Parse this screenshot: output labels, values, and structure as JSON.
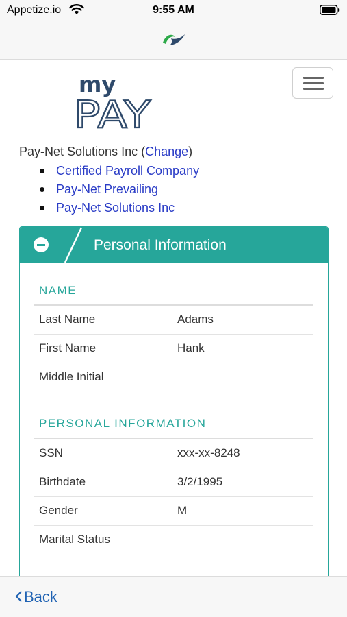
{
  "status_bar": {
    "carrier": "Appetize.io",
    "time": "9:55 AM",
    "icons": [
      "wifi-icon",
      "battery-icon"
    ]
  },
  "header": {
    "logo_icon": "paynet-logo-icon",
    "brand_logo_top": "my",
    "brand_logo_bottom": "PAY",
    "menu_icon": "hamburger-menu-icon"
  },
  "company": {
    "current": "Pay-Net Solutions Inc",
    "open_paren": " (",
    "change_link": "Change",
    "close_paren": ")",
    "options": [
      "Certified Payroll Company",
      "Pay-Net Prevailing",
      "Pay-Net Solutions Inc"
    ]
  },
  "panel": {
    "title": "Personal Information",
    "collapse_icon": "minus-circle-icon",
    "sections": [
      {
        "title": "NAME",
        "rows": [
          {
            "label": "Last Name",
            "value": "Adams"
          },
          {
            "label": "First Name",
            "value": "Hank"
          },
          {
            "label": "Middle Initial",
            "value": ""
          }
        ]
      },
      {
        "title": "PERSONAL INFORMATION",
        "rows": [
          {
            "label": "SSN",
            "value": "xxx-xx-8248"
          },
          {
            "label": "Birthdate",
            "value": "3/2/1995"
          },
          {
            "label": "Gender",
            "value": "M"
          },
          {
            "label": "Marital Status",
            "value": ""
          }
        ]
      }
    ]
  },
  "nav": {
    "back_label": "Back",
    "back_icon": "chevron-left-icon"
  },
  "colors": {
    "accent": "#26a69a",
    "link": "#2a3cc6",
    "back_link": "#1f62b3",
    "logo_navy": "#2f4a6b",
    "logo_green": "#2eaa4a"
  }
}
